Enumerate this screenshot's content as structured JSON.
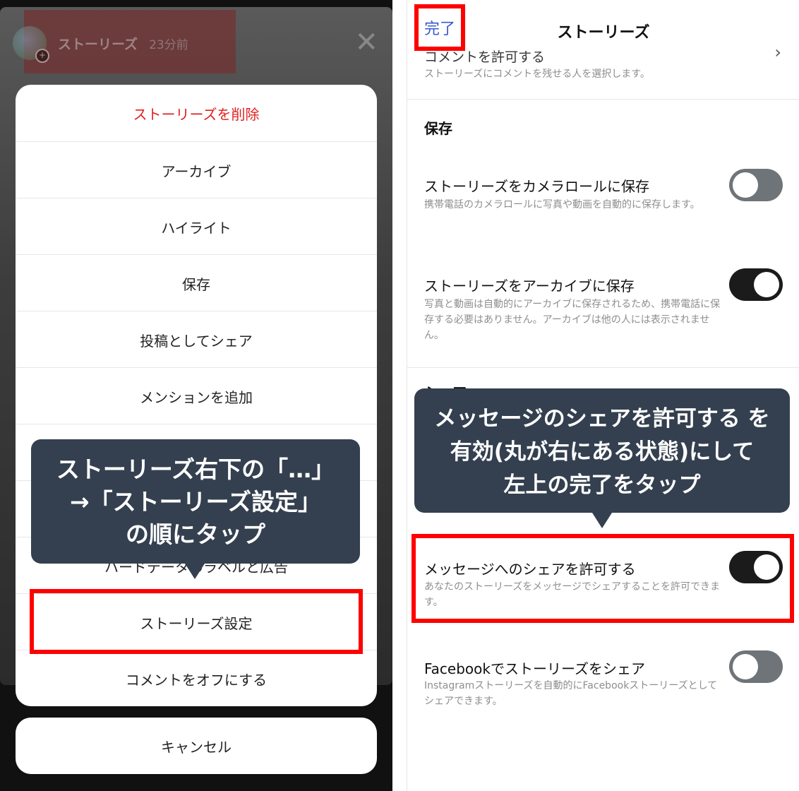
{
  "left": {
    "story": {
      "username": "ストーリーズ",
      "time": "23分前"
    },
    "menu": [
      {
        "label": "ストーリーズを削除",
        "danger": true
      },
      {
        "label": "アーカイブ"
      },
      {
        "label": "ハイライト"
      },
      {
        "label": "保存"
      },
      {
        "label": "投稿としてシェア"
      },
      {
        "label": "メンションを追加"
      },
      {
        "label": ""
      },
      {
        "label": ""
      },
      {
        "label": "ハードデータのラベルと広告"
      },
      {
        "label": "ストーリーズ設定"
      },
      {
        "label": "コメントをオフにする"
      }
    ],
    "cancel": "キャンセル",
    "callout": [
      "ストーリーズ右下の「…」",
      "→「ストーリーズ設定」",
      "の順にタップ"
    ]
  },
  "right": {
    "nav": {
      "done": "完了",
      "title": "ストーリーズ"
    },
    "partial_row": {
      "title": "コメントを許可する",
      "desc": "ストーリーズにコメントを残せる人を選択します。"
    },
    "save_section": {
      "title": "保存",
      "rows": [
        {
          "title": "ストーリーズをカメラロールに保存",
          "desc": "携帯電話のカメラロールに写真や動画を自動的に保存します。",
          "toggle": "off"
        },
        {
          "title": "ストーリーズをアーカイブに保存",
          "desc": "写真と動画は自動的にアーカイブに保存されるため、携帯電話に保存する必要はありません。アーカイブは他の人には表示されません。",
          "toggle": "on"
        }
      ]
    },
    "share_section": {
      "title": "シェア",
      "rows": [
        {
          "title": "メッセージへのシェアを許可する",
          "desc": "あなたのストーリーズをメッセージでシェアすることを許可できます。",
          "toggle": "on"
        },
        {
          "title": "Facebookでストーリーズをシェア",
          "desc": "Instagramストーリーズを自動的にFacebookストーリーズとしてシェアできます。",
          "toggle": "off"
        }
      ]
    },
    "callout": [
      "メッセージのシェアを許可する を",
      "有効(丸が右にある状態)にして",
      "左上の完了をタップ"
    ]
  },
  "colors": {
    "highlight": "#ff0000",
    "callout_bg": "#34404f",
    "danger": "#e02020",
    "link": "#3a59d1"
  }
}
